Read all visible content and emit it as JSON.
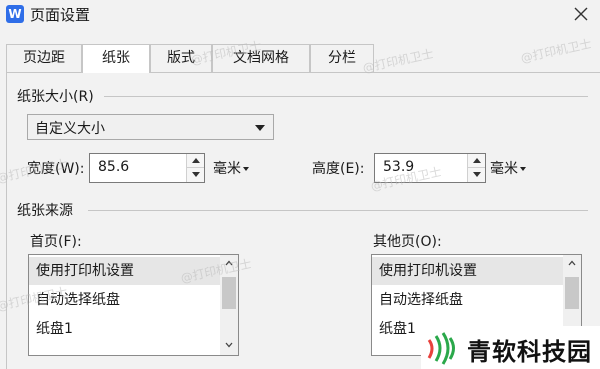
{
  "window": {
    "app_icon_letter": "W",
    "title": "页面设置"
  },
  "tabs": [
    {
      "label": "页边距",
      "active": false
    },
    {
      "label": "纸张",
      "active": true
    },
    {
      "label": "版式",
      "active": false
    },
    {
      "label": "文档网格",
      "active": false
    },
    {
      "label": "分栏",
      "active": false
    }
  ],
  "paper_size": {
    "section_title": "纸张大小(R)",
    "selected": "自定义大小",
    "width_label": "宽度(W):",
    "width_value": "85.6",
    "width_unit": "毫米",
    "height_label": "高度(E):",
    "height_value": "53.9",
    "height_unit": "毫米"
  },
  "paper_source": {
    "section_title": "纸张来源",
    "first_page_label": "首页(F):",
    "first_page_items": [
      "使用打印机设置",
      "自动选择纸盘",
      "纸盘1"
    ],
    "other_pages_label": "其他页(O):",
    "other_pages_items": [
      "使用打印机设置",
      "自动选择纸盘",
      "纸盘1"
    ]
  },
  "watermark_text": "@打印机卫士",
  "brand": {
    "name": "青软科技园"
  },
  "colors": {
    "accent": "#2f6ee8",
    "brand_green": "#2aa84a",
    "brand_red": "#e8413c"
  }
}
